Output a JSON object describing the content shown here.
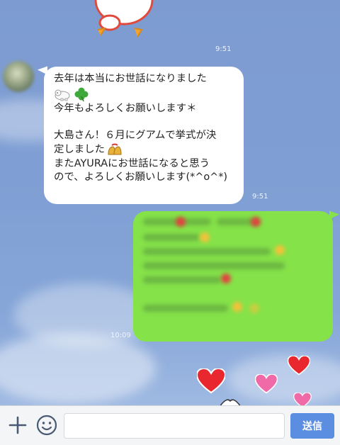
{
  "chat": {
    "top_time": "9:51",
    "incoming": {
      "lines": [
        "去年は本当にお世話になりました",
        "今年もよろしくお願いします＊",
        "大島さん！６月にグアムで挙式が決",
        "定しました",
        "またAYURAにお世話になると思う",
        "ので、よろしくお願いします(*^o^*)"
      ],
      "time": "9:51"
    },
    "outgoing": {
      "time": "10:09"
    }
  },
  "input_bar": {
    "message_value": "",
    "send_label": "送信"
  },
  "colors": {
    "incoming_bubble": "#ffffff",
    "outgoing_bubble": "#85e249",
    "send_button": "#5b8ee0"
  }
}
